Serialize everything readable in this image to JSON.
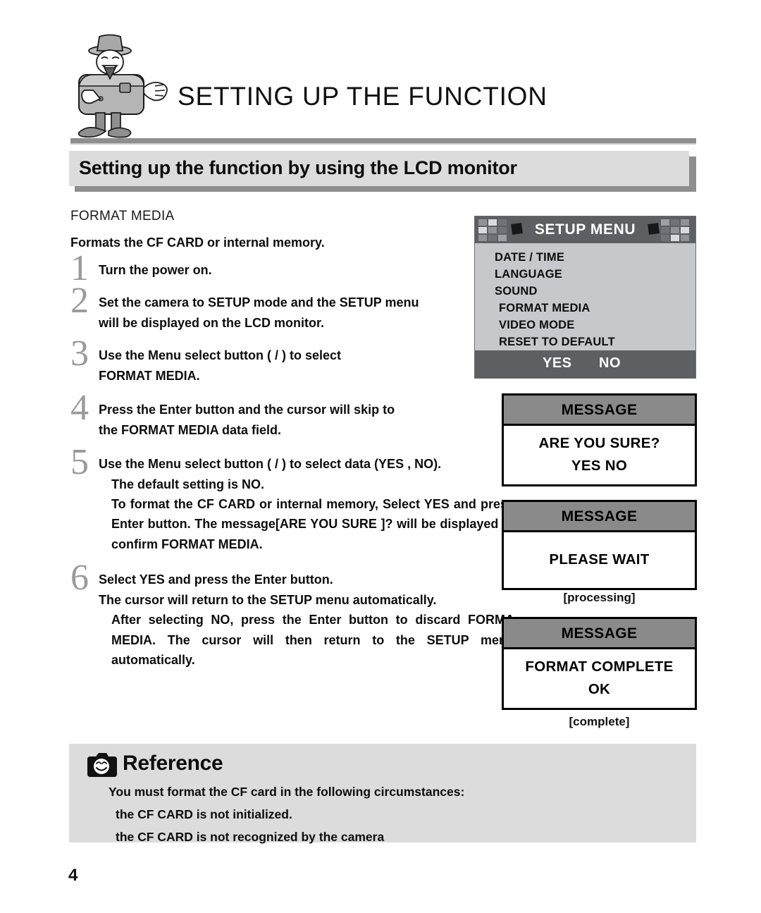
{
  "header": {
    "main_title": "SETTING UP THE FUNCTION",
    "mascot_icon": "camera-mascot-character"
  },
  "section": {
    "title": "Setting up the function by using the LCD monitor"
  },
  "instructions": {
    "topic": "FORMAT MEDIA",
    "summary": "Formats the CF CARD or internal memory.",
    "steps": [
      {
        "number": "1",
        "lines": [
          "Turn the power on."
        ]
      },
      {
        "number": "2",
        "lines": [
          "Set the camera to SETUP mode and the SETUP menu",
          "will be displayed on the LCD monitor."
        ]
      },
      {
        "number": "3",
        "lines": [
          "Use the Menu select  button ( /    ) to select",
          "FORMAT MEDIA."
        ]
      },
      {
        "number": "4",
        "lines": [
          "Press the Enter button and the cursor will skip to",
          "the FORMAT MEDIA data field."
        ]
      },
      {
        "number": "5",
        "lines": [
          "Use the Menu select button ( /    ) to select data (YES , NO).",
          "The default setting is NO."
        ],
        "paragraph_pre": "To format the CF CARD or internal memory, Select YES and press Enter button. The message",
        "paragraph_msg": "[ARE YOU SURE ]?",
        "paragraph_post": "will be displayed to confirm FORMAT MEDIA."
      },
      {
        "number": "6",
        "lines": [
          "Select YES and press the Enter button.",
          "The cursor will return to the SETUP menu automatically."
        ],
        "paragraph": "After selecting NO, press the Enter button to discard FORMA MEDIA. The cursor will then return to the SETUP menu automatically."
      }
    ]
  },
  "setup_menu": {
    "title": "SETUP MENU",
    "items": [
      "DATE / TIME",
      "LANGUAGE",
      "SOUND",
      "FORMAT MEDIA",
      "VIDEO MODE",
      "RESET TO DEFAULT"
    ],
    "footer": {
      "yes": "YES",
      "no": "NO"
    },
    "colors": {
      "header_bg": "#5d5f63",
      "body_bg": "#c6c8cb",
      "title_text": "#ffffff"
    }
  },
  "messages": [
    {
      "header": "MESSAGE",
      "lines": [
        "ARE YOU SURE?",
        "YES   NO"
      ],
      "caption": ""
    },
    {
      "header": "MESSAGE",
      "lines": [
        "PLEASE WAIT"
      ],
      "caption": "[processing]"
    },
    {
      "header": "MESSAGE",
      "lines": [
        "FORMAT COMPLETE",
        "OK"
      ],
      "caption": "[complete]"
    }
  ],
  "reference": {
    "icon": "camera-smiley-icon",
    "title": "Reference",
    "lines": [
      "You must format the CF card in the following circumstances:",
      "the CF CARD is not initialized.",
      "the CF CARD is not recognized by the camera"
    ]
  },
  "page_number": "4"
}
